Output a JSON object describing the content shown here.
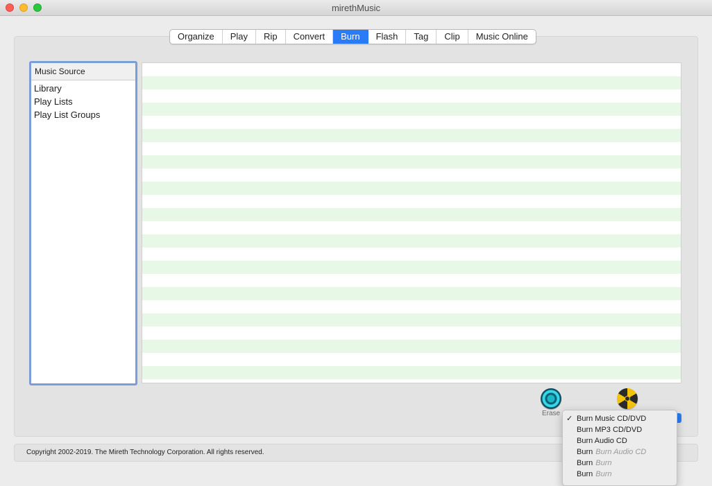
{
  "window": {
    "title": "mirethMusic"
  },
  "tabs": [
    {
      "label": "Organize"
    },
    {
      "label": "Play"
    },
    {
      "label": "Rip"
    },
    {
      "label": "Convert"
    },
    {
      "label": "Burn",
      "active": true
    },
    {
      "label": "Flash"
    },
    {
      "label": "Tag"
    },
    {
      "label": "Clip"
    },
    {
      "label": "Music Online"
    }
  ],
  "source": {
    "header": "Music Source",
    "items": [
      "Library",
      "Play Lists",
      "Play List Groups"
    ]
  },
  "actions": {
    "erase_label": "Erase",
    "erase_icon": "erase-disc-icon",
    "burn_icon": "burn-radiation-icon"
  },
  "burn_menu": {
    "check": "✓",
    "items": [
      {
        "label": "Burn Music CD/DVD",
        "checked": true
      },
      {
        "label": "Burn MP3 CD/DVD"
      },
      {
        "label": "Burn Audio CD"
      },
      {
        "label": "Burn",
        "ghost": "Burn Audio CD"
      },
      {
        "label": "Burn",
        "ghost": "Burn"
      },
      {
        "label": "Burn",
        "ghost": "Burn"
      }
    ]
  },
  "status": {
    "copyright": "Copyright 2002-2019.  The Mireth Technology Corporation. All rights reserved."
  },
  "colors": {
    "accent": "#2a7cf6",
    "row_stripe": "#e7f8e7",
    "source_border": "#7b9edb"
  }
}
